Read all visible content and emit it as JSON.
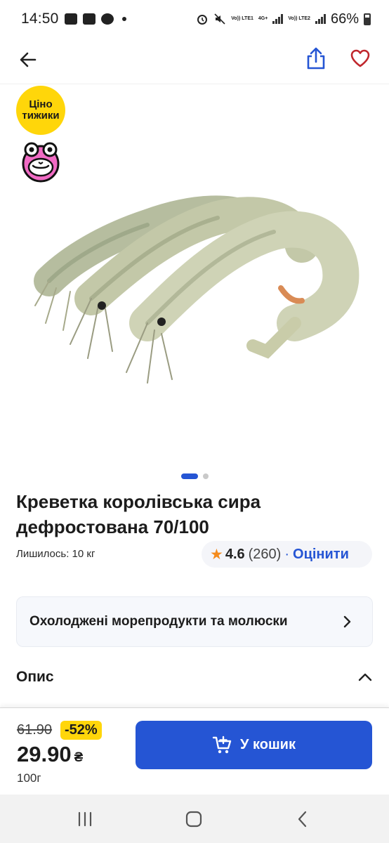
{
  "status_bar": {
    "time": "14:50",
    "battery": "66%",
    "sim1_label": "Vo)) LTE1",
    "sim2_label": "Vo)) LTE2",
    "network": "4G+"
  },
  "header": {
    "back_icon": "arrow-left-icon",
    "share_icon": "share-icon",
    "favorite_icon": "heart-icon",
    "favorite_color": "#c0272d",
    "share_color": "#2555d4"
  },
  "promo": {
    "badge_line1": "Ціно",
    "badge_line2": "тижики",
    "badge_color": "#ffd60a"
  },
  "gallery": {
    "total_pages": 2,
    "active_page": 1
  },
  "product": {
    "title": "Креветка королівська сира дефростована 70/100",
    "stock": "Лишилось: 10 кг",
    "rating": "4.6",
    "review_count": "(260)",
    "rate_link": "Оцінити"
  },
  "category": {
    "label": "Охолоджені морепродукти та молюски"
  },
  "description": {
    "label": "Опис",
    "expanded": true
  },
  "buy": {
    "old_price": "61.90",
    "discount": "-52%",
    "price": "29.90",
    "currency": "₴",
    "unit": "100г",
    "cart_label": "У кошик",
    "accent": "#2555d4"
  }
}
